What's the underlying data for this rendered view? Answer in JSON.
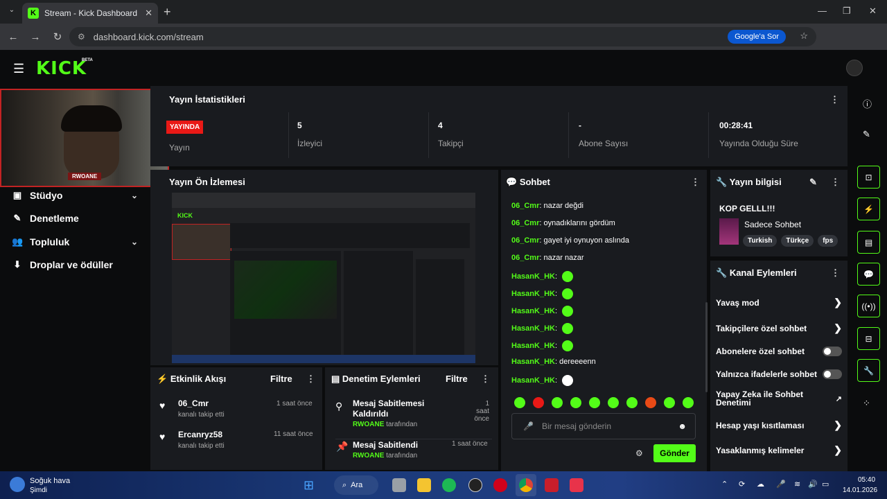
{
  "browser": {
    "tab_title": "Stream - Kick Dashboard",
    "tab_favicon": "K",
    "url": "dashboard.kick.com/stream",
    "google_button": "Google'a Sor"
  },
  "app": {
    "logo": "KICK",
    "beta": "BETA",
    "brand_color": "#53fc18"
  },
  "sidebar": {
    "items": [
      {
        "label": "Stüdyo",
        "icon": "studio-icon",
        "has_chevron": true
      },
      {
        "label": "Denetleme",
        "icon": "wrench-icon",
        "has_chevron": false
      },
      {
        "label": "Topluluk",
        "icon": "community-icon",
        "has_chevron": true
      },
      {
        "label": "Droplar ve ödüller",
        "icon": "drops-icon",
        "has_chevron": false
      }
    ]
  },
  "webcam": {
    "name": "RWOANE"
  },
  "stats": {
    "title": "Yayın İstatistikleri",
    "live_badge": "YAYINDA",
    "live_sub": "Yayın",
    "items": [
      {
        "value": "5",
        "label": "İzleyici"
      },
      {
        "value": "4",
        "label": "Takipçi"
      },
      {
        "value": "-",
        "label": "Abone Sayısı"
      },
      {
        "value": "00:28:41",
        "label": "Yayında Olduğu Süre"
      }
    ]
  },
  "preview": {
    "title": "Yayın Ön İzlemesi"
  },
  "chat": {
    "title": "Sohbet",
    "messages": [
      {
        "user": "06_Cmr",
        "text": "nazar değdi"
      },
      {
        "user": "06_Cmr",
        "text": "oynadıklarını gördüm"
      },
      {
        "user": "06_Cmr",
        "text": "gayet iyi oynuyon aslında"
      },
      {
        "user": "06_Cmr",
        "text": "nazar nazar"
      },
      {
        "user": "HasanK_HK",
        "text": ""
      },
      {
        "user": "HasanK_HK",
        "text": ""
      },
      {
        "user": "HasanK_HK",
        "text": ""
      },
      {
        "user": "HasanK_HK",
        "text": ""
      },
      {
        "user": "HasanK_HK",
        "text": ""
      },
      {
        "user": "HasanK_HK",
        "text": "dereeeenn"
      },
      {
        "user": "HasanK_HK",
        "text": ""
      }
    ],
    "input_placeholder": "Bir mesaj gönderin",
    "send_label": "Gönder"
  },
  "stream_info": {
    "title": "Yayın bilgisi",
    "stream_title": "KOP GELLL!!!",
    "category": "Sadece Sohbet",
    "tags": [
      "Turkish",
      "Türkçe",
      "fps"
    ]
  },
  "channel_actions": {
    "title": "Kanal Eylemleri",
    "items": [
      {
        "label": "Yavaş mod",
        "control": "arrow"
      },
      {
        "label": "Takipçilere özel sohbet",
        "control": "arrow"
      },
      {
        "label": "Abonelere özel sohbet",
        "control": "toggle"
      },
      {
        "label": "Yalnızca ifadelerle sohbet",
        "control": "toggle"
      },
      {
        "label": "Yapay Zeka ile Sohbet Denetimi",
        "control": "external"
      },
      {
        "label": "Hesap yaşı kısıtlaması",
        "control": "arrow"
      },
      {
        "label": "Yasaklanmış kelimeler",
        "control": "arrow"
      }
    ]
  },
  "activity": {
    "title": "Etkinlik Akışı",
    "filter": "Filtre",
    "items": [
      {
        "name": "06_Cmr",
        "sub": "kanalı takip etti",
        "time": "1 saat önce"
      },
      {
        "name": "Ercanryz58",
        "sub": "kanalı takip etti",
        "time": "11 saat önce"
      }
    ]
  },
  "moderation": {
    "title": "Denetim Eylemleri",
    "filter": "Filtre",
    "by_suffix": "tarafından",
    "items": [
      {
        "title": "Mesaj Sabitlemesi Kaldırıldı",
        "by": "RWOANE",
        "time": "1 saat önce"
      },
      {
        "title": "Mesaj Sabitlendi",
        "by": "RWOANE",
        "time": "1 saat önce"
      }
    ]
  },
  "taskbar": {
    "weather_title": "Soğuk hava",
    "weather_sub": "Şimdi",
    "search": "Ara",
    "time": "05:40",
    "date": "14.01.2026"
  }
}
